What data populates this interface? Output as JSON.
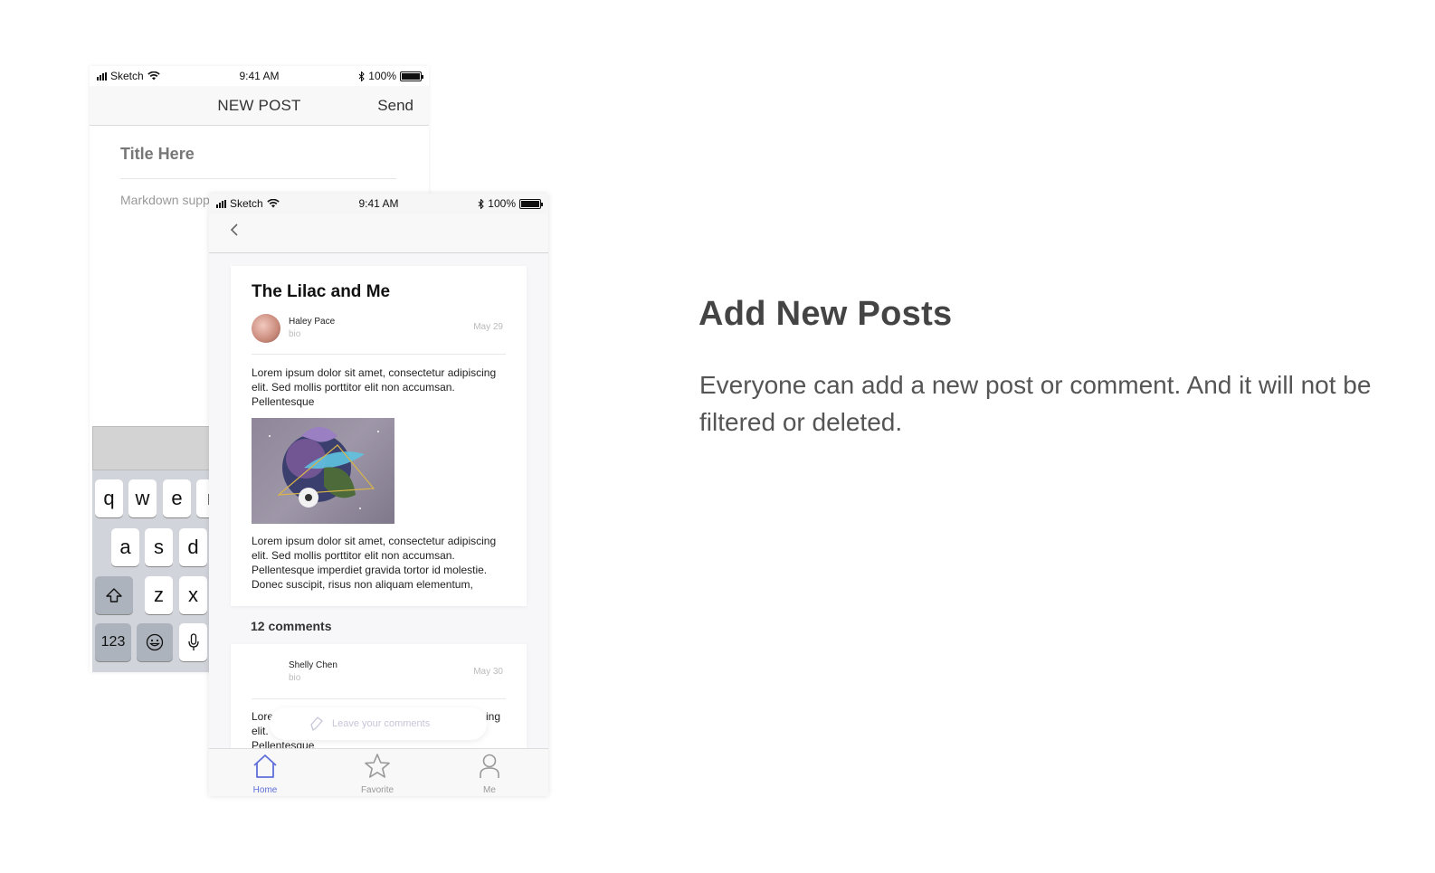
{
  "new_post_screen": {
    "status": {
      "carrier": "Sketch",
      "time": "9:41 AM",
      "battery": "100%"
    },
    "nav": {
      "title": "NEW POST",
      "send_label": "Send"
    },
    "title_placeholder": "Title Here",
    "body_placeholder": "Markdown supp",
    "keyboard": {
      "row1": [
        "q",
        "w",
        "e",
        "r"
      ],
      "row2": [
        "a",
        "s",
        "d"
      ],
      "row3": [
        "z",
        "x"
      ],
      "numbers_label": "123"
    }
  },
  "post_screen": {
    "status": {
      "carrier": "Sketch",
      "time": "9:41 AM",
      "battery": "100%"
    },
    "post": {
      "title": "The Lilac and Me",
      "author": "Haley Pace",
      "bio": "bio",
      "date": "May 29",
      "paragraph1": "Lorem ipsum dolor sit amet, consectetur adipiscing elit. Sed mollis porttitor elit non accumsan. Pellentesque",
      "paragraph2": "Lorem ipsum dolor sit amet, consectetur adipiscing elit. Sed mollis porttitor elit non accumsan. Pellentesque imperdiet gravida tortor id molestie. Donec suscipit, risus non aliquam elementum,"
    },
    "comments_count": "12 comments",
    "comment": {
      "author": "Shelly Chen",
      "bio": "bio",
      "date": "May 30",
      "text_start": "Lore",
      "text_line2": "elit.",
      "text_line3": "Pellentesque",
      "text_end": "ing"
    },
    "comment_input_placeholder": "Leave your comments",
    "tabs": [
      {
        "label": "Home",
        "icon": "home-icon",
        "active": true
      },
      {
        "label": "Favorite",
        "icon": "star-icon",
        "active": false
      },
      {
        "label": "Me",
        "icon": "person-icon",
        "active": false
      }
    ],
    "accent_color": "#5e6fd8"
  },
  "feature": {
    "headline": "Add New Posts",
    "description": "Everyone can add a new post or comment. And it will not be filtered or deleted."
  }
}
